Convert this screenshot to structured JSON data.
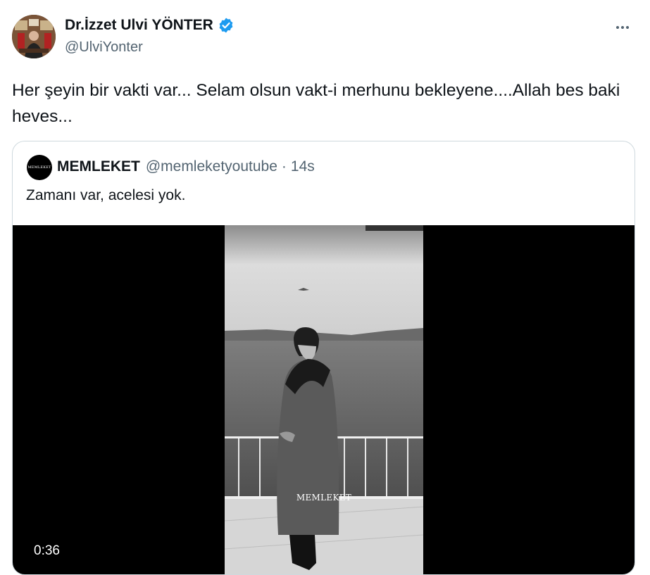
{
  "author": {
    "name": "Dr.İzzet Ulvi YÖNTER",
    "handle": "@UlviYonter",
    "verified": true
  },
  "tweet": {
    "text": "Her şeyin bir vakti var... Selam olsun vakt-i merhunu bekleyene....Allah bes baki heves..."
  },
  "quote": {
    "avatar_text": "MEMLEKET",
    "name": "MEMLEKET",
    "handle": "@memleketyoutube",
    "separator": "·",
    "time": "14s",
    "text": "Zamanı var, acelesi yok.",
    "video": {
      "watermark": "MEMLEKET",
      "duration": "0:36"
    }
  },
  "icons": {
    "verified": "verified-badge-icon",
    "more": "more-icon"
  },
  "colors": {
    "verified_blue": "#1d9bf0",
    "text_primary": "#0f1419",
    "text_secondary": "#536471",
    "border": "#cfd9de"
  }
}
